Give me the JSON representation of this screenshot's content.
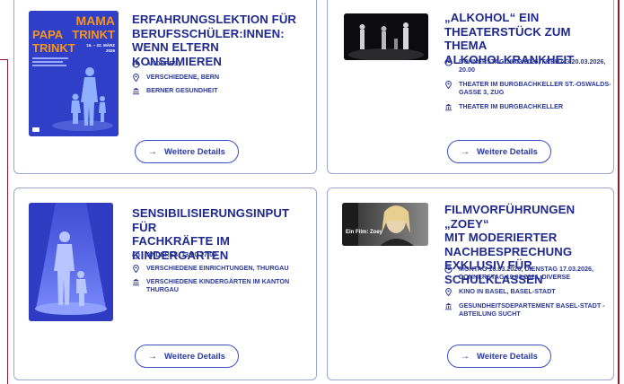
{
  "events": [
    {
      "title": "Erfahrungslektion für Berufsschüler:innen: Wenn Eltern konsumieren",
      "title_lines": [
        "ERFAHRUNGSLEKTION FÜR",
        "BERUFSSCHÜLER:INNEN:",
        "WENN ELTERN KONSUMIEREN"
      ],
      "date": "ANDERES,",
      "location": "VERSCHIEDENE, BERN",
      "organizer": "BERNER GESUNDHEIT",
      "poster": {
        "line1": "MAMA",
        "line2a": "PAPA",
        "line2b": "TRINKT",
        "line3": "TRINKT",
        "dates": "16. – 22. MÄRZ",
        "year": "2026"
      },
      "button": "Weitere Details"
    },
    {
      "title": "„Alkohol“ ein Theaterstück zum Thema Alkoholkrankheit",
      "title_lines": [
        "„ALKOHOL“ EIN",
        "THEATERSTÜCK ZUM THEMA",
        "ALKOHOLKRANKHEIT"
      ],
      "date": "DONNERSTAG 19.03.2026, FREITAG 20.03.2026, 20.00",
      "location": "THEATER IM BURGBACHKELLER ST.-OSWALDS-GASSE 3, ZUG",
      "organizer": "THEATER IM BURGBACHKELLER",
      "button": "Weitere Details"
    },
    {
      "title": "Sensibilisierungsinput für Fachkräfte im Kindergarten",
      "title_lines": [
        "SENSIBILISIERUNGSINPUT FÜR",
        "FACHKRÄFTE IM",
        "KINDERGARTEN"
      ],
      "date": "ANDERES, 13:00-17:00",
      "location": "VERSCHIEDENE EINRICHTUNGEN, THURGAU",
      "organizer": "VERSCHIEDENE KINDERGÄRTEN IM KANTON THURGAU",
      "button": "Weitere Details"
    },
    {
      "title": "Filmvorführungen „Zoey“ mit moderierter Nachbesprechung exklusiv für Schulklassen",
      "title_lines": [
        "FILMVORFÜHRUNGEN „ZOEY“",
        "MIT MODERIERTER",
        "NACHBESPRECHUNG",
        "EXKLUSIV FÜR SCHULKLASSEN"
      ],
      "date": "MONTAG 16.03.2026, DIENSTAG 17.03.2026, DONNERSTAG 19.03.2026, DIVERSE",
      "location": "KINO IN BASEL, BASEL-STADT",
      "organizer": "GESUNDHEITSDEPARTEMENT BASEL-STADT - ABTEILUNG SUCHT",
      "film_label": "Ein Film: Zoey",
      "button": "Weitere Details"
    }
  ],
  "icons": {
    "date": "clock-icon",
    "location": "location-pin-icon",
    "organizer": "institution-icon",
    "button": "arrow-right-icon"
  },
  "colors": {
    "title": "#1f2a8c",
    "meta": "#2a3898",
    "border": "#9aa6d0",
    "button": "#3b4fc4",
    "poster_blue": "#2f3fc7",
    "poster_orange": "#f7941d",
    "frame": "#8a1c2b"
  }
}
